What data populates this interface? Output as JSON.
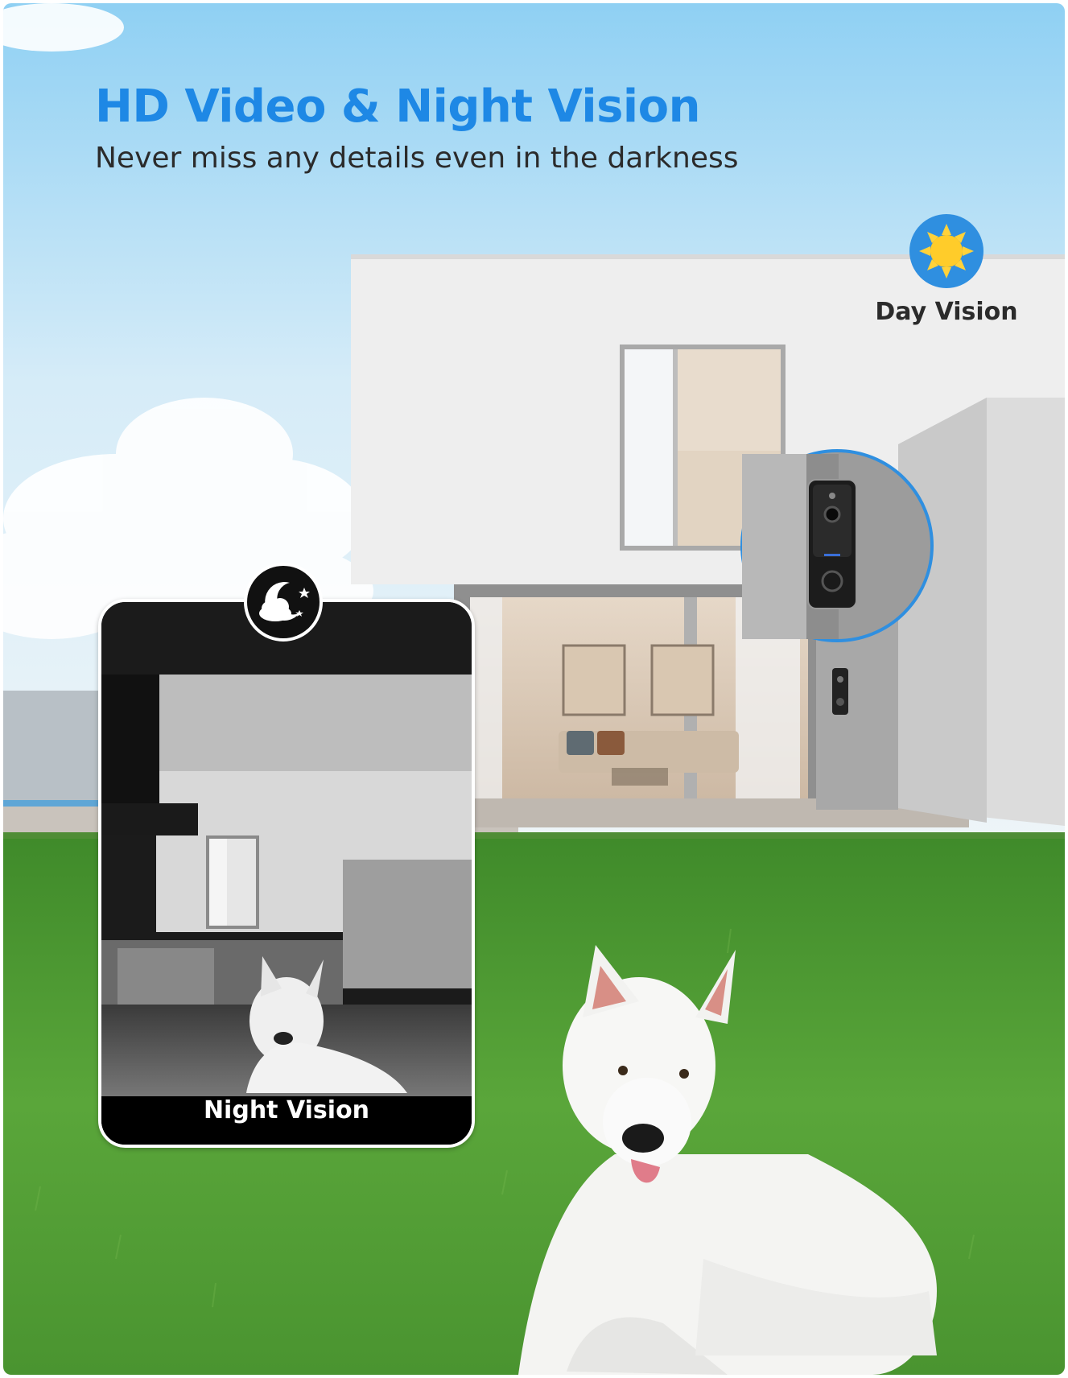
{
  "headline": "HD Video & Night Vision",
  "subheadline": "Never miss any details even in the darkness",
  "day_vision_label": "Day Vision",
  "night_vision_label": "Night Vision",
  "icons": {
    "day": "sun-icon",
    "night": "moon-cloud-stars-icon"
  },
  "colors": {
    "accent": "#1e88e5",
    "text": "#2b2b2b",
    "grass": "#4f9a32",
    "sky": "#cfe8f7"
  }
}
